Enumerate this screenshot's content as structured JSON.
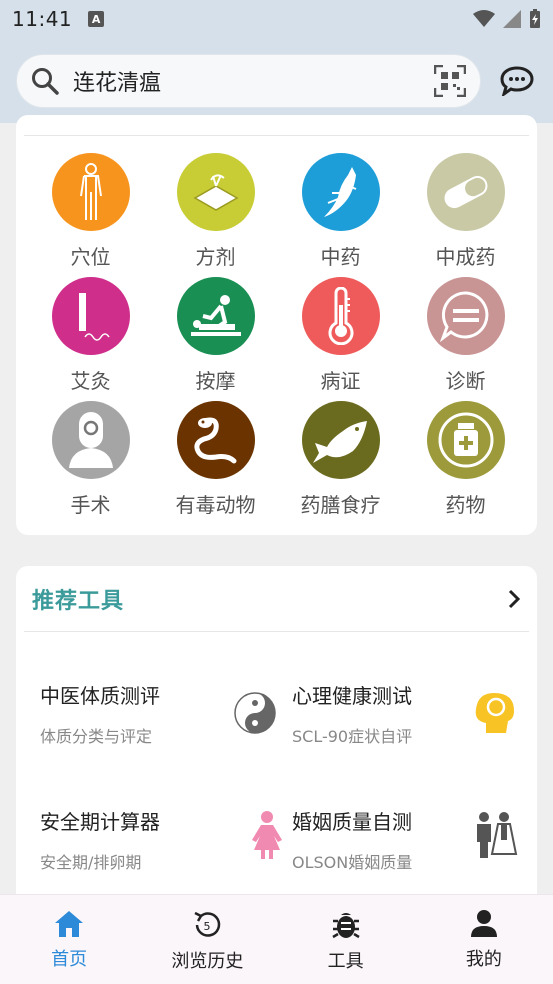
{
  "status": {
    "time": "11:41"
  },
  "search": {
    "query": "连花清瘟"
  },
  "categories": [
    {
      "label": "穴位",
      "color": "#f7941d"
    },
    {
      "label": "方剂",
      "color": "#c8cc35"
    },
    {
      "label": "中药",
      "color": "#1e9ed8"
    },
    {
      "label": "中成药",
      "color": "#c9c9a6"
    },
    {
      "label": "艾灸",
      "color": "#cf2f8b"
    },
    {
      "label": "按摩",
      "color": "#1a8f54"
    },
    {
      "label": "病证",
      "color": "#ef5b5b"
    },
    {
      "label": "诊断",
      "color": "#c99494"
    },
    {
      "label": "手术",
      "color": "#a5a5a5"
    },
    {
      "label": "有毒动物",
      "color": "#6b3300"
    },
    {
      "label": "药膳食疗",
      "color": "#6b6b1f"
    },
    {
      "label": "药物",
      "color": "#9c9a3a"
    }
  ],
  "tools": {
    "title": "推荐工具",
    "items": [
      {
        "name": "中医体质测评",
        "desc": "体质分类与评定"
      },
      {
        "name": "心理健康测试",
        "desc": "SCL-90症状自评"
      },
      {
        "name": "安全期计算器",
        "desc": "安全期/排卵期"
      },
      {
        "name": "婚姻质量自测",
        "desc": "OLSON婚姻质量"
      }
    ]
  },
  "nav": [
    {
      "label": "首页",
      "active": true
    },
    {
      "label": "浏览历史",
      "badge": "5"
    },
    {
      "label": "工具"
    },
    {
      "label": "我的"
    }
  ],
  "colors": {
    "accent": "#2d8ad8",
    "section_title": "#3b9a9a",
    "header_bg": "#d5e0ea"
  }
}
